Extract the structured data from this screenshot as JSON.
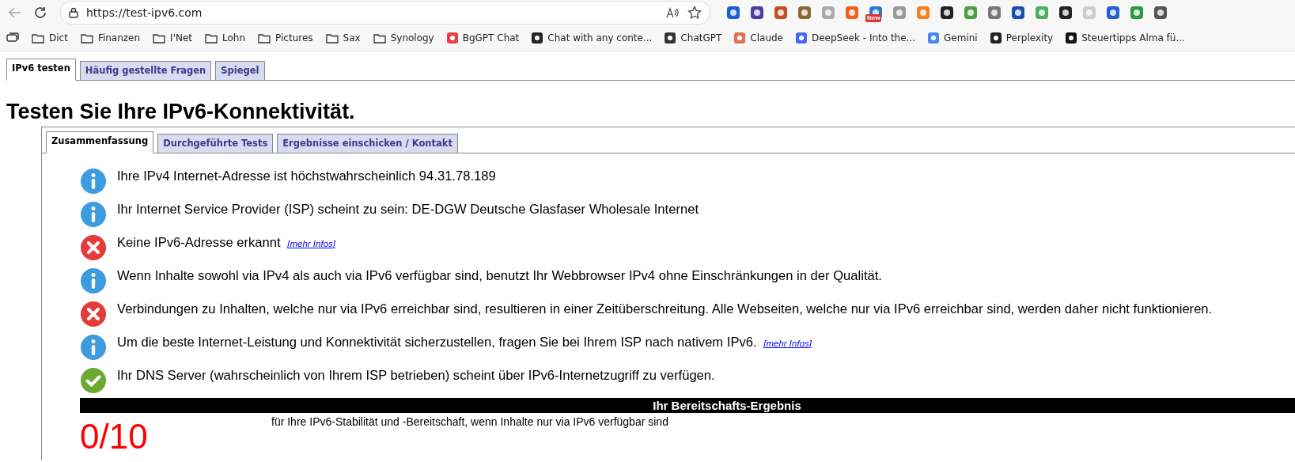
{
  "browser": {
    "url": "https://test-ipv6.com",
    "extension_badge": "New",
    "bookmarks": [
      {
        "kind": "apps"
      },
      {
        "kind": "folder",
        "label": "Dict"
      },
      {
        "kind": "folder",
        "label": "Finanzen"
      },
      {
        "kind": "folder",
        "label": "I'Net"
      },
      {
        "kind": "folder",
        "label": "Lohn"
      },
      {
        "kind": "folder",
        "label": "Pictures"
      },
      {
        "kind": "folder",
        "label": "Sax"
      },
      {
        "kind": "folder",
        "label": "Synology"
      },
      {
        "kind": "site",
        "label": "BgGPT Chat"
      },
      {
        "kind": "site",
        "label": "Chat with any conte..."
      },
      {
        "kind": "site",
        "label": "ChatGPT"
      },
      {
        "kind": "site",
        "label": "Claude"
      },
      {
        "kind": "site",
        "label": "DeepSeek - Into the..."
      },
      {
        "kind": "site",
        "label": "Gemini"
      },
      {
        "kind": "site",
        "label": "Perplexity"
      },
      {
        "kind": "site",
        "label": "Steuertipps Alma fü..."
      }
    ]
  },
  "tabs": [
    {
      "label": "IPv6 testen",
      "selected": true
    },
    {
      "label": "Häufig gestellte Fragen",
      "selected": false
    },
    {
      "label": "Spiegel",
      "selected": false
    }
  ],
  "heading": "Testen Sie Ihre IPv6-Konnektivität.",
  "subtabs": [
    {
      "label": "Zusammenfassung",
      "selected": true
    },
    {
      "label": "Durchgeführte Tests",
      "selected": false
    },
    {
      "label": "Ergebnisse einschicken / Kontakt",
      "selected": false
    }
  ],
  "messages": [
    {
      "kind": "info",
      "text": "Ihre IPv4 Internet-Adresse ist höchstwahrscheinlich 94.31.78.189"
    },
    {
      "kind": "info",
      "text": "Ihr Internet Service Provider (ISP) scheint zu sein: DE-DGW Deutsche Glasfaser Wholesale Internet"
    },
    {
      "kind": "error",
      "text": "Keine IPv6-Adresse erkannt",
      "link": "[mehr Infos]"
    },
    {
      "kind": "info",
      "text": "Wenn Inhalte sowohl via IPv4 als auch via IPv6 verfügbar sind, benutzt Ihr Webbrowser IPv4 ohne Einschränkungen in der Qualität."
    },
    {
      "kind": "error",
      "text": "Verbindungen zu Inhalten, welche nur via IPv6 erreichbar sind, resultieren in einer Zeitüberschreitung. Alle Webseiten, welche nur via IPv6 erreichbar sind, werden daher nicht funktionieren."
    },
    {
      "kind": "info",
      "text": "Um die beste Internet-Leistung und Konnektivität sicherzustellen, fragen Sie bei Ihrem ISP nach nativem IPv6.",
      "link": "[mehr Infos]"
    },
    {
      "kind": "ok",
      "text": "Ihr DNS Server (wahrscheinlich von Ihrem ISP betrieben) scheint über IPv6-Internetzugriff zu verfügen."
    }
  ],
  "score": {
    "title": "Ihr Bereitschafts-Ergebnis",
    "value": "0/10",
    "caption": "für Ihre IPv6-Stabilität und -Bereitschaft, wenn Inhalte nur via IPv6 verfügbar sind"
  }
}
